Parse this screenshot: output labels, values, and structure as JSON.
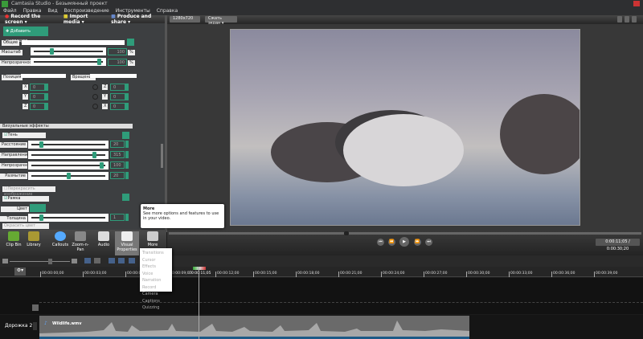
{
  "window": {
    "title": "Camtasia Studio - Безымянный проект"
  },
  "menu": [
    "Файл",
    "Правка",
    "Вид",
    "Воспроизведение",
    "Инструменты",
    "Справка"
  ],
  "toolbar": {
    "record": "Record the screen ▾",
    "import": "Import media ▾",
    "produce": "Produce and share ▾"
  },
  "preview_toolbar": {
    "size": "1280x720",
    "zoom": "Сжать экран ▾"
  },
  "properties": {
    "add_animation": "Добавить анимацию",
    "general": "Общие",
    "scale_label": "Масштаб",
    "scale_value": "100",
    "scale_unit": "%",
    "scale_fraction": 0.25,
    "opacity_label": "Непрозрачность",
    "opacity_value": "100",
    "opacity_unit": "%",
    "opacity_fraction": 0.98,
    "position": "Позиция",
    "rotation": "Вращение",
    "pos": [
      {
        "axis": "X",
        "value": "0"
      },
      {
        "axis": "Y",
        "value": "0"
      },
      {
        "axis": "Z",
        "value": "0"
      }
    ],
    "rot": [
      {
        "axis": "Z",
        "value": "0"
      },
      {
        "axis": "Y",
        "value": "0"
      },
      {
        "axis": "X",
        "value": "0"
      }
    ],
    "visual_effects": "Визуальные эффекты",
    "shadow": "Тень",
    "shadow_params": [
      {
        "label": "Расстояние",
        "value": "20",
        "fraction": 0.12
      },
      {
        "label": "Направление",
        "value": "315",
        "fraction": 0.87
      },
      {
        "label": "Непрозрачность",
        "value": "100",
        "fraction": 0.98
      },
      {
        "label": "Размытие",
        "value": "20",
        "fraction": 0.5
      }
    ],
    "recolor": "Перекрасить изображение",
    "border": "Рамка",
    "color_label": "Цвет",
    "thickness_label": "Толщина",
    "thickness_value": "1",
    "thickness_fraction": 0.12,
    "colorize": "Окрасить цвет"
  },
  "tools": [
    "Clip Bin",
    "Library",
    "Callouts",
    "Zoom-n-Pan",
    "Audio",
    "Visual Properties",
    "More"
  ],
  "tooltip": {
    "title": "More",
    "body": "See more options and features to use in your video."
  },
  "more_menu": [
    "Transitions",
    "Cursor Effects",
    "Voice Narration",
    "Record Camera",
    "Captions",
    "Quizzing"
  ],
  "player": {
    "time": "0:00:11;05 / 0:00:30;20",
    "position_fraction": 0.37
  },
  "timeline": {
    "ticks": [
      "00:00:00;00",
      "00:00:03;00",
      "00:00:06;00",
      "00:00:09;00",
      "00:00:12;00",
      "00:00:15;00",
      "00:00:18;00",
      "00:00:21;00",
      "00:00:24;00",
      "00:00:27;00",
      "00:00:30;00",
      "00:00:33;00",
      "00:00:36;00",
      "00:00:39;00"
    ],
    "playhead": "00:00:11;05",
    "track_label": "Дорожка 2",
    "clip_name": "Wildlife.wmv"
  },
  "colors": {
    "accent": "#2f9c7a",
    "clip_bar": "#1d5a86"
  }
}
